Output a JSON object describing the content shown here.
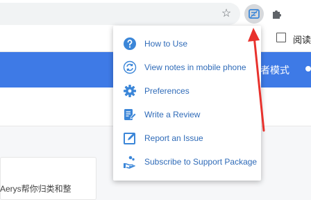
{
  "toolbar": {
    "icons": {
      "star": "bookmark-star-icon",
      "extension": "extension-notes-icon",
      "puzzle": "extensions-puzzle-icon"
    },
    "bookmark_star_glyph": "☆"
  },
  "bookmarks_bar": {
    "reader_label": "阅读"
  },
  "page": {
    "reader_mode_label": "者模式",
    "card_text": "Aerys帮你归类和整"
  },
  "menu": {
    "items": [
      {
        "label": "How to Use",
        "icon": "help-question-icon"
      },
      {
        "label": "View notes in mobile phone",
        "icon": "sync-icon"
      },
      {
        "label": "Preferences",
        "icon": "gear-icon"
      },
      {
        "label": "Write a Review",
        "icon": "review-edit-icon"
      },
      {
        "label": "Report an Issue",
        "icon": "report-edit-icon"
      },
      {
        "label": "Subscribe to Support Package",
        "icon": "support-hand-icon"
      }
    ]
  },
  "colors": {
    "accent": "#3e7ae6",
    "menu_text": "#2f6bb8",
    "icon_blue": "#3b86d8",
    "arrow": "#e8322d"
  }
}
